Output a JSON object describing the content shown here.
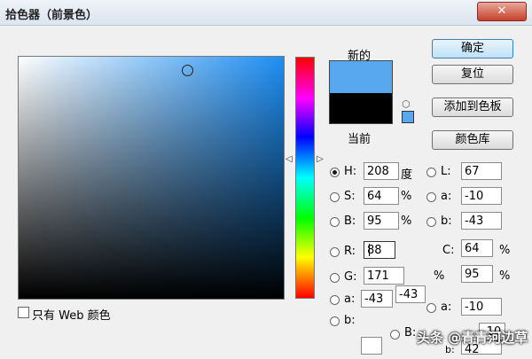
{
  "title": "拾色器（前景色）",
  "close_symbol": "✕",
  "swatch": {
    "new_label": "新的",
    "current_label": "当前",
    "new_color": "#58a8f0",
    "current_color": "#000000"
  },
  "buttons": {
    "ok": "确定",
    "reset": "复位",
    "add_to_swatches": "添加到色板",
    "color_libraries": "颜色库"
  },
  "hsb": {
    "h": {
      "label": "H:",
      "value": "208",
      "unit": "度"
    },
    "s": {
      "label": "S:",
      "value": "64",
      "unit": "%"
    },
    "b": {
      "label": "B:",
      "value": "95",
      "unit": "%"
    }
  },
  "rgb": {
    "r": {
      "label": "R:",
      "value": "88"
    },
    "g": {
      "label": "G:",
      "value": "171"
    },
    "b": {
      "label": "b:",
      "value": ""
    }
  },
  "lab": {
    "l": {
      "label": "L:",
      "value": "67"
    },
    "a": {
      "label": "a:",
      "value": "-10"
    },
    "b": {
      "label": "b:",
      "value": "-43"
    }
  },
  "cmyk": {
    "c": {
      "label": "C:",
      "value": "64",
      "unit": "%"
    },
    "m": {
      "unit": "%",
      "value": "95"
    }
  },
  "ghost": {
    "a_label": "a:",
    "a_value1": "-43",
    "a_value2": "-43",
    "a2_label": "a:",
    "a2_value": "-10",
    "b2_label": "B:",
    "b2_value": "-10",
    "b3_label": "b:",
    "b3_value": "42"
  },
  "web_only": "只有 Web 颜色",
  "watermark": "头条 @青青河边草",
  "marker_symbol": "◁",
  "cube_symbol": "⬡"
}
